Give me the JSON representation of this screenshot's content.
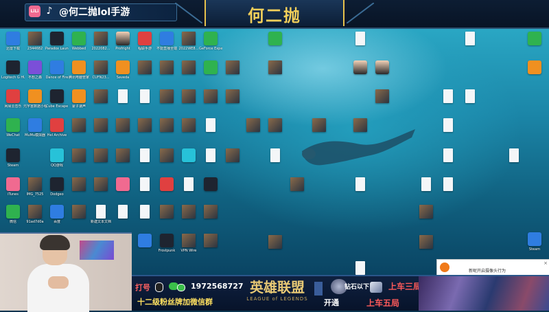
{
  "banner": {
    "app_logo_text": "LiLi",
    "account": "@何二抛lol手游",
    "title": "何二抛"
  },
  "footer": {
    "qq_label": "打号",
    "qq_number": "1972568727",
    "fans_text": "十二级粉丝牌加微信群",
    "lol_cn": "英雄联盟",
    "lol_en": "LEAGUE of LEGENDS",
    "rank_under": "钻石以下",
    "kaiyou": "开通",
    "up3": "上车三局",
    "up5": "上车五局"
  },
  "notification": {
    "text": "新呢开启摄像头行为"
  },
  "desktop_icons": [
    {
      "label": "迅雷下载",
      "kind": "blue"
    },
    {
      "label": "2344682",
      "kind": "pic"
    },
    {
      "label": "Paradox Launcher v2",
      "kind": "dark"
    },
    {
      "label": "Webbed",
      "kind": "green"
    },
    {
      "label": "2022082...",
      "kind": "pic"
    },
    {
      "label": "Profright",
      "kind": "face"
    },
    {
      "label": "程联手游",
      "kind": "red"
    },
    {
      "label": "不能直播全端",
      "kind": "blue"
    },
    {
      "label": "2022WE8...",
      "kind": "pic"
    },
    {
      "label": "GeForce Experience",
      "kind": "green"
    },
    {
      "label": "Logitech G HUB",
      "kind": "dark"
    },
    {
      "label": "不想之森",
      "kind": "purple"
    },
    {
      "label": "Dance of Fire",
      "kind": "blue"
    },
    {
      "label": "腾讯电脑管家",
      "kind": "blue"
    },
    {
      "label": "CUFN23...",
      "kind": "pic"
    },
    {
      "label": "Saveda",
      "kind": "orange"
    },
    {
      "label": "网易云音乐",
      "kind": "red"
    },
    {
      "label": "元宇宙数据小程序",
      "kind": "orange"
    },
    {
      "label": "Cube Escape",
      "kind": "dark"
    },
    {
      "label": "蒙子速声",
      "kind": "orange"
    },
    {
      "label": "WeChat",
      "kind": "green"
    },
    {
      "label": "MuMu模拟器",
      "kind": "blue"
    },
    {
      "label": "Hel Archive",
      "kind": "red"
    },
    {
      "label": "QQ游戏",
      "kind": "cyan"
    },
    {
      "label": "Steam",
      "kind": "dark"
    },
    {
      "label": "iTunes",
      "kind": "pink"
    },
    {
      "label": "IMG_7525",
      "kind": "pic"
    },
    {
      "label": "Dodgeo",
      "kind": "dark"
    },
    {
      "label": "微信",
      "kind": "green"
    },
    {
      "label": "91ad7d0a",
      "kind": "pic"
    },
    {
      "label": "百度",
      "kind": "blue"
    },
    {
      "label": "新建文本文档",
      "kind": "doc"
    },
    {
      "label": "Frostpunk",
      "kind": "dark"
    },
    {
      "label": "VPN Wire",
      "kind": "pic"
    },
    {
      "label": "Steam",
      "kind": "blue"
    }
  ]
}
